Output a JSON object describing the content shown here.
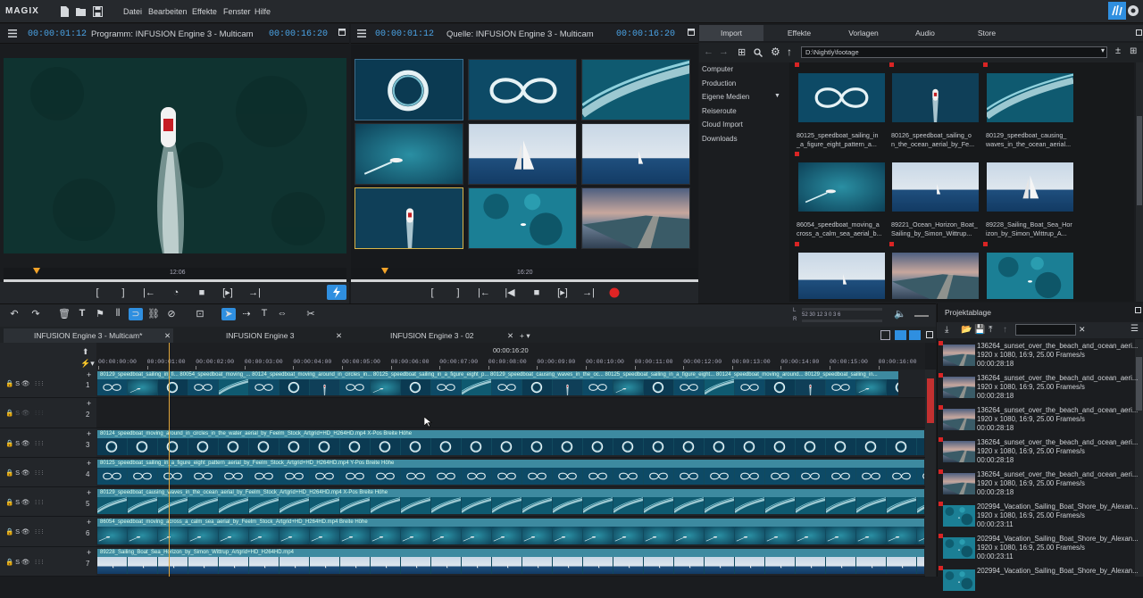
{
  "app": {
    "logo": "MAGIX"
  },
  "menu": [
    "Datei",
    "Bearbeiten",
    "Effekte",
    "Fenster",
    "Hilfe"
  ],
  "program_monitor": {
    "timecode_left": "00:00:01:12",
    "title": "Programm: INFUSION Engine 3 - Multicam",
    "timecode_right": "00:00:16:20",
    "ruler_label": "12:06"
  },
  "source_monitor": {
    "timecode_left": "00:00:01:12",
    "title": "Quelle: INFUSION Engine 3 - Multicam",
    "timecode_right": "00:00:16:20",
    "ruler_label": "16:20"
  },
  "browser": {
    "tabs": [
      "Import",
      "Effekte",
      "Vorlagen",
      "Audio",
      "Store"
    ],
    "path": "D:\\Nightly\\footage",
    "nav": [
      "Computer",
      "Production",
      "Eigene Medien",
      "Reiseroute",
      "Cloud Import",
      "Downloads"
    ],
    "files": [
      {
        "line1": "80125_speedboat_sailing_in",
        "line2": "_a_figure_eight_pattern_a...",
        "thumb": "ring"
      },
      {
        "line1": "80126_speedboat_sailing_o",
        "line2": "n_the_ocean_aerial_by_Fe...",
        "thumb": "boat"
      },
      {
        "line1": "80129_speedboat_causing_",
        "line2": "waves_in_the_ocean_aerial...",
        "thumb": "wave"
      },
      {
        "line1": "86054_speedboat_moving_a",
        "line2": "cross_a_calm_sea_aerial_b...",
        "thumb": "calm"
      },
      {
        "line1": "89221_Ocean_Horizon_Boat_",
        "line2": "Sailing_by_Simon_Wittrup...",
        "thumb": "horizon"
      },
      {
        "line1": "89228_Sailing_Boat_Sea_Hor",
        "line2": "izon_by_Simon_Wittrup_A...",
        "thumb": "sail"
      }
    ]
  },
  "timeline": {
    "tabs": [
      "INFUSION Engine 3 - Multicam*",
      "INFUSION Engine 3",
      "INFUSION Engine 3 - 02"
    ],
    "center_timecode": "00:00:16:20",
    "ruler": [
      "00:00:00:00",
      "00:00:01:00",
      "00:00:02:00",
      "00:00:03:00",
      "00:00:04:00",
      "00:00:05:00",
      "00:00:06:00",
      "00:00:07:00",
      "00:00:08:00",
      "00:00:09:00",
      "00:00:10:00",
      "00:00:11:00",
      "00:00:12:00",
      "00:00:13:00",
      "00:00:14:00",
      "00:00:15:00",
      "00:00:16:00"
    ],
    "meter_scale": "52 30 12 3 0 3 6",
    "tracks": [
      {
        "num": "1",
        "label": "80129_speedboat_sailing_in_fi...  80054_speedboat_moving_...  80124_speedboat_moving_around_in_circles_in...  80125_speedboat_sailing_in_a_figure_eight_p...  80129_speedboat_causing_waves_in_the_oc...  80125_speedboat_sailing_in_a_figure_eight...  80124_speedboat_moving_around...  80129_speedboat_sailing_in..."
      },
      {
        "num": "2",
        "label": ""
      },
      {
        "num": "3",
        "label": "80124_speedboat_moving_around_in_circles_in_the_water_aerial_by_Feelm_Stock_Artgrid+HD_H264HD.mp4  X-Pos  Breite Höhe"
      },
      {
        "num": "4",
        "label": "80125_speedboat_sailing_in_a_figure_eight_pattern_aerial_by_Feelm_Stock_Artgrid+HD_H264HD.mp4  Y-Pos  Breite Höhe"
      },
      {
        "num": "5",
        "label": "80129_speedboat_causing_waves_in_the_ocean_aerial_by_Feelm_Stock_Artgrid+HD_H264HD.mp4  X-Pos  Breite Höhe"
      },
      {
        "num": "6",
        "label": "86054_speedboat_moving_across_a_calm_sea_aerial_by_Feelm_Stock_Artgrid+HD_H264HD.mp4  Breite Höhe"
      },
      {
        "num": "7",
        "label": "89228_Sailing_Boat_Sea_Horizon_by_Simon_Wittrup_Artgrid+HD_H264HD.mp4"
      }
    ]
  },
  "project_bin": {
    "title": "Projektablage",
    "items": [
      {
        "name": "136264_sunset_over_the_beach_and_ocean_aeri...",
        "info": "1920 x 1080, 16:9, 25.00 Frames/s",
        "dur": "00:00:28:18"
      },
      {
        "name": "136264_sunset_over_the_beach_and_ocean_aeri...",
        "info": "1920 x 1080, 16:9, 25.00 Frames/s",
        "dur": "00:00:28:18"
      },
      {
        "name": "136264_sunset_over_the_beach_and_ocean_aeri...",
        "info": "1920 x 1080, 16:9, 25.00 Frames/s",
        "dur": "00:00:28:18"
      },
      {
        "name": "136264_sunset_over_the_beach_and_ocean_aeri...",
        "info": "1920 x 1080, 16:9, 25.00 Frames/s",
        "dur": "00:00:28:18"
      },
      {
        "name": "136264_sunset_over_the_beach_and_ocean_aeri...",
        "info": "1920 x 1080, 16:9, 25.00 Frames/s",
        "dur": "00:00:28:18"
      },
      {
        "name": "202994_Vacation_Sailing_Boat_Shore_by_Alexan...",
        "info": "1920 x 1080, 16:9, 25.00 Frames/s",
        "dur": "00:00:23:11"
      },
      {
        "name": "202994_Vacation_Sailing_Boat_Shore_by_Alexan...",
        "info": "1920 x 1080, 16:9, 25.00 Frames/s",
        "dur": "00:00:23:11"
      },
      {
        "name": "202994_Vacation_Sailing_Boat_Shore_by_Alexan...",
        "info": "",
        "dur": ""
      }
    ]
  },
  "colors": {
    "accent": "#2f8fe0",
    "clip": "#3d8aa0",
    "record": "#e02424"
  }
}
